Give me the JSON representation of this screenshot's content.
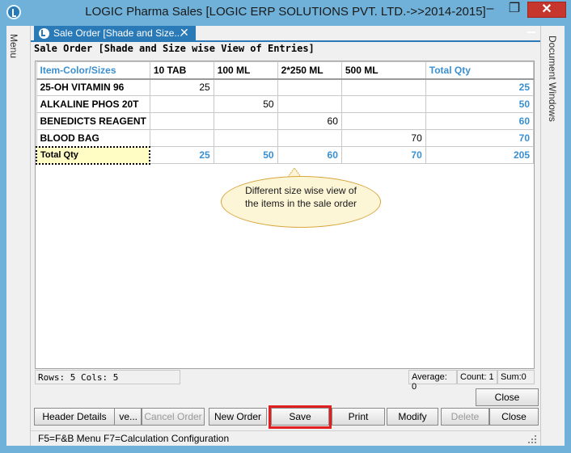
{
  "window": {
    "title": "LOGIC Pharma Sales  [LOGIC ERP SOLUTIONS PVT. LTD.->>2014-2015]",
    "minimize": "–",
    "maximize": "❐",
    "close": "✕"
  },
  "sidebar_left": {
    "label": "Menu"
  },
  "sidebar_right": {
    "label": "Document Windows"
  },
  "doc_tab": {
    "label": "Sale Order [Shade and Size...",
    "close": "✕"
  },
  "form": {
    "title": "Sale Order [Shade and Size wise View of Entries]"
  },
  "grid": {
    "headers": [
      "Item-Color/Sizes",
      "10 TAB",
      "100 ML",
      "2*250 ML",
      "500 ML",
      "Total Qty"
    ],
    "rows": [
      {
        "item": "25-OH VITAMIN 96",
        "cells": [
          "25",
          "",
          "",
          ""
        ],
        "total": "25"
      },
      {
        "item": "ALKALINE PHOS 20T",
        "cells": [
          "",
          "50",
          "",
          ""
        ],
        "total": "50"
      },
      {
        "item": "BENEDICTS REAGENT",
        "cells": [
          "",
          "",
          "60",
          ""
        ],
        "total": "60"
      },
      {
        "item": "BLOOD BAG",
        "cells": [
          "",
          "",
          "",
          "70"
        ],
        "total": "70"
      }
    ],
    "total_row": {
      "label": "Total Qty",
      "cells": [
        "25",
        "50",
        "60",
        "70"
      ],
      "total": "205"
    }
  },
  "callout": {
    "text": "Different size wise view of the items in the sale order"
  },
  "status": {
    "rows_cols": "Rows: 5  Cols: 5",
    "average": "Average: 0",
    "count": "Count: 1",
    "sum": "Sum:0"
  },
  "buttons": {
    "close_top": "Close",
    "header_details": "Header Details",
    "save_partial": "ve...",
    "cancel_order": "Cancel Order",
    "new_order": "New Order",
    "save": "Save",
    "print": "Print",
    "modify": "Modify",
    "delete": "Delete",
    "close": "Close"
  },
  "footer": {
    "text": "F5=F&B Menu  F7=Calculation Configuration"
  },
  "colors": {
    "accent": "#2a7ab8",
    "frame": "#6fb1d9",
    "highlight": "#e02020",
    "total_text": "#3a8fd0"
  }
}
